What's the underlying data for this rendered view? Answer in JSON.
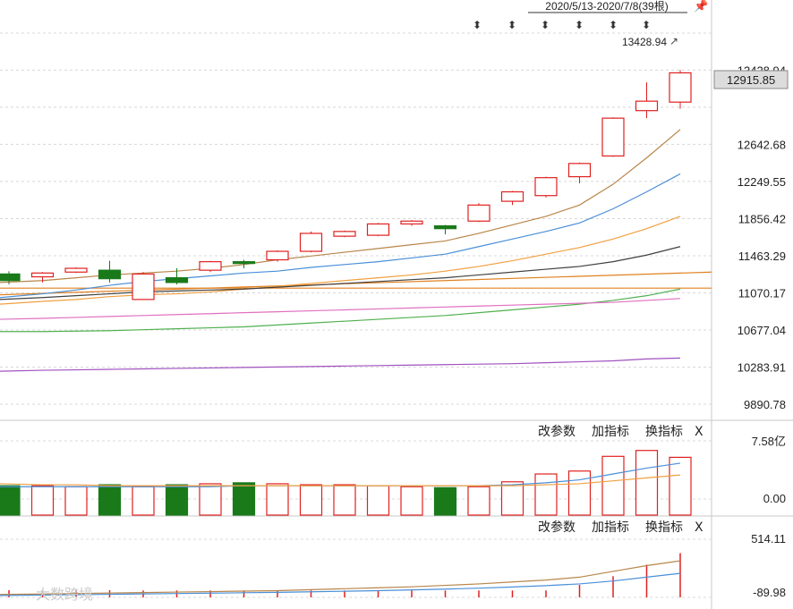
{
  "header": {
    "range_label": "2020/5/13-2020/7/8(39根)",
    "high_annotation": "13428.94"
  },
  "current_price": "12915.85",
  "panels": {
    "volume": {
      "buttons": [
        "改参数",
        "加指标",
        "换指标",
        "X"
      ]
    },
    "indicator": {
      "buttons": [
        "改参数",
        "加指标",
        "换指标",
        "X"
      ]
    }
  },
  "watermark": "大数跨境",
  "colors": {
    "up": "#e02020",
    "down": "#1a7a1a",
    "ma_brown": "#b8864b",
    "ma_blue": "#4a8fd8",
    "ma_orange": "#f0a040",
    "ma_dark": "#404040",
    "ma_green": "#50b050",
    "ma_pink": "#e070c0",
    "ma_purple": "#a050c0",
    "flat_orange": "#e08020"
  },
  "chart_data": [
    {
      "type": "candlestick",
      "yticks": [
        "13428.94",
        "12642.68",
        "12249.55",
        "11856.42",
        "11463.29",
        "11070.17",
        "10677.04",
        "10283.91",
        "9890.78"
      ],
      "ylim": [
        9890.78,
        13821.07
      ],
      "candles": [
        {
          "o": 11270,
          "c": 11200,
          "h": 11300,
          "l": 11160
        },
        {
          "o": 11240,
          "c": 11280,
          "h": 11290,
          "l": 11180
        },
        {
          "o": 11290,
          "c": 11330,
          "h": 11340,
          "l": 11280
        },
        {
          "o": 11310,
          "c": 11220,
          "h": 11410,
          "l": 11180
        },
        {
          "o": 11000,
          "c": 11270,
          "h": 11290,
          "l": 11000
        },
        {
          "o": 11230,
          "c": 11180,
          "h": 11330,
          "l": 11160
        },
        {
          "o": 11310,
          "c": 11400,
          "h": 11410,
          "l": 11290
        },
        {
          "o": 11400,
          "c": 11390,
          "h": 11420,
          "l": 11330
        },
        {
          "o": 11420,
          "c": 11510,
          "h": 11520,
          "l": 11400
        },
        {
          "o": 11510,
          "c": 11700,
          "h": 11720,
          "l": 11500
        },
        {
          "o": 11670,
          "c": 11720,
          "h": 11730,
          "l": 11660
        },
        {
          "o": 11680,
          "c": 11800,
          "h": 11810,
          "l": 11670
        },
        {
          "o": 11800,
          "c": 11830,
          "h": 11840,
          "l": 11780
        },
        {
          "o": 11780,
          "c": 11750,
          "h": 11790,
          "l": 11690
        },
        {
          "o": 11830,
          "c": 12000,
          "h": 12020,
          "l": 11820
        },
        {
          "o": 12040,
          "c": 12140,
          "h": 12150,
          "l": 12000
        },
        {
          "o": 12100,
          "c": 12290,
          "h": 12300,
          "l": 12080
        },
        {
          "o": 12300,
          "c": 12440,
          "h": 12450,
          "l": 12230
        },
        {
          "o": 12520,
          "c": 12920,
          "h": 12930,
          "l": 12510
        },
        {
          "o": 13000,
          "c": 13100,
          "h": 13300,
          "l": 12920
        },
        {
          "o": 13090,
          "c": 13400,
          "h": 13428.94,
          "l": 13020
        }
      ],
      "moving_averages": [
        {
          "color": "ma_brown",
          "values": [
            11180,
            11200,
            11230,
            11260,
            11280,
            11300,
            11330,
            11370,
            11420,
            11460,
            11500,
            11540,
            11580,
            11620,
            11700,
            11790,
            11880,
            12000,
            12220,
            12500,
            12800
          ]
        },
        {
          "color": "ma_blue",
          "values": [
            11020,
            11060,
            11100,
            11150,
            11190,
            11220,
            11250,
            11280,
            11300,
            11340,
            11370,
            11400,
            11440,
            11480,
            11560,
            11640,
            11720,
            11810,
            11960,
            12140,
            12330
          ]
        },
        {
          "color": "ma_orange",
          "values": [
            10950,
            10980,
            11000,
            11030,
            11050,
            11060,
            11080,
            11110,
            11140,
            11170,
            11200,
            11230,
            11260,
            11300,
            11350,
            11410,
            11480,
            11550,
            11640,
            11750,
            11880
          ]
        },
        {
          "color": "ma_dark",
          "values": [
            11000,
            11020,
            11040,
            11060,
            11080,
            11090,
            11100,
            11110,
            11130,
            11150,
            11170,
            11190,
            11210,
            11230,
            11260,
            11290,
            11320,
            11350,
            11400,
            11470,
            11560
          ]
        },
        {
          "color": "ma_green",
          "values": [
            10660,
            10660,
            10665,
            10670,
            10680,
            10690,
            10700,
            10710,
            10730,
            10750,
            10770,
            10790,
            10810,
            10830,
            10860,
            10890,
            10920,
            10950,
            10990,
            11040,
            11110
          ]
        },
        {
          "color": "ma_pink",
          "values": [
            10790,
            10800,
            10810,
            10820,
            10830,
            10840,
            10850,
            10860,
            10870,
            10880,
            10890,
            10900,
            10910,
            10920,
            10930,
            10940,
            10950,
            10960,
            10970,
            10990,
            11010
          ]
        },
        {
          "color": "ma_purple",
          "values": [
            10240,
            10250,
            10255,
            10260,
            10265,
            10270,
            10275,
            10280,
            10285,
            10290,
            10295,
            10300,
            10305,
            10310,
            10315,
            10320,
            10330,
            10340,
            10350,
            10370,
            10380
          ]
        }
      ]
    },
    {
      "type": "bar",
      "yticks": [
        "7.58亿",
        "0.00"
      ],
      "ylim": [
        0,
        7.58
      ],
      "values": [
        3.0,
        3.0,
        2.9,
        3.1,
        2.9,
        3.1,
        3.2,
        3.3,
        3.2,
        3.1,
        3.1,
        3.0,
        2.9,
        2.8,
        2.9,
        3.4,
        4.2,
        4.5,
        6.0,
        6.6,
        5.9
      ]
    },
    {
      "type": "bar",
      "yticks": [
        "514.11",
        "-89.98"
      ],
      "ylim": [
        -89.98,
        514.11
      ],
      "values": [
        -15,
        -15,
        -15,
        -15,
        -18,
        -18,
        -18,
        -18,
        -18,
        -18,
        -18,
        -18,
        -18,
        -18,
        -18,
        -18,
        -18,
        40,
        130,
        250,
        370
      ]
    }
  ]
}
